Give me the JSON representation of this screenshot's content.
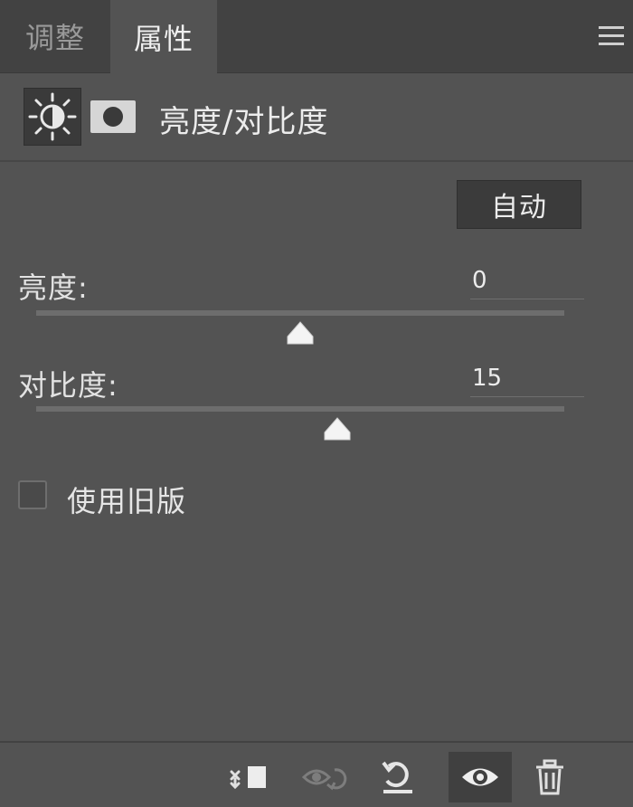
{
  "tabs": [
    {
      "label": "调整",
      "active": false
    },
    {
      "label": "属性",
      "active": true
    }
  ],
  "header": {
    "title": "亮度/对比度",
    "icons": [
      "brightness-contrast-icon",
      "layer-mask-icon"
    ]
  },
  "auto_button": {
    "label": "自动"
  },
  "brightness": {
    "label": "亮度:",
    "value": "0",
    "slider_fraction": 0.5
  },
  "contrast": {
    "label": "对比度:",
    "value": "15",
    "slider_fraction": 0.57
  },
  "legacy": {
    "label": "使用旧版",
    "checked": false
  },
  "toolbar": {
    "icons": [
      "clip-to-layer-icon",
      "view-previous-state-icon",
      "reset-icon",
      "visibility-eye-icon",
      "trash-icon"
    ]
  },
  "colors": {
    "panel_bg": "#535353",
    "tabbar_bg": "#424242",
    "text": "#e6e6e6"
  }
}
